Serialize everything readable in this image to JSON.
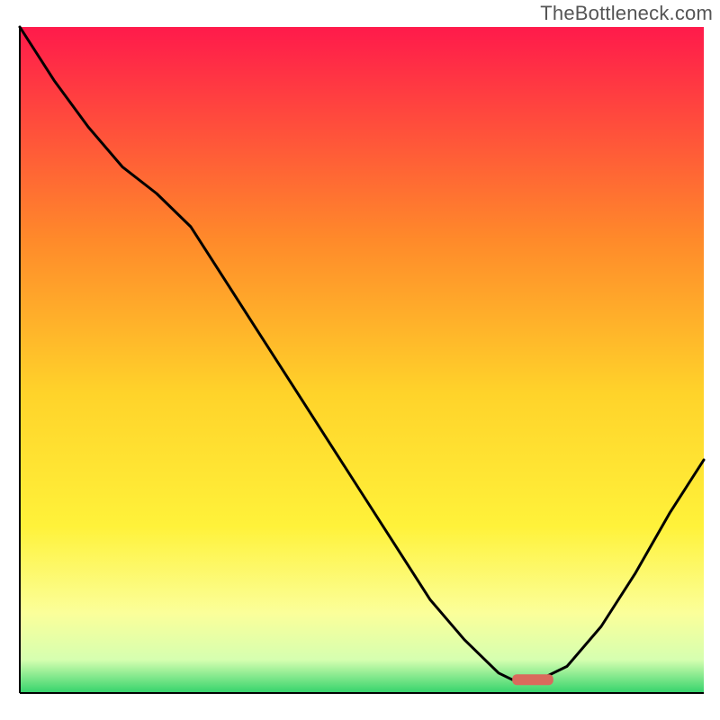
{
  "watermark": "TheBottleneck.com",
  "chart_data": {
    "type": "line",
    "title": "",
    "xlabel": "",
    "ylabel": "",
    "xlim": [
      0,
      100
    ],
    "ylim": [
      0,
      100
    ],
    "background": {
      "gradient_top": "#ff1a4b",
      "gradient_mid_upper": "#ff9b2a",
      "gradient_mid": "#ffd62a",
      "gradient_lower": "#fff97a",
      "gradient_bottom": "#34d36b"
    },
    "series": [
      {
        "name": "bottleneck-curve",
        "color": "#000000",
        "x": [
          0,
          5,
          10,
          15,
          20,
          25,
          30,
          35,
          40,
          45,
          50,
          55,
          60,
          65,
          70,
          72,
          76,
          80,
          85,
          90,
          95,
          100
        ],
        "values": [
          100,
          92,
          85,
          79,
          75,
          70,
          62,
          54,
          46,
          38,
          30,
          22,
          14,
          8,
          3,
          2,
          2,
          4,
          10,
          18,
          27,
          35
        ]
      }
    ],
    "annotations": [
      {
        "name": "min-marker",
        "shape": "rounded-rect",
        "color": "#d96a5c",
        "x_start": 72,
        "x_end": 78,
        "y": 2
      }
    ],
    "grid": false,
    "legend": false
  }
}
